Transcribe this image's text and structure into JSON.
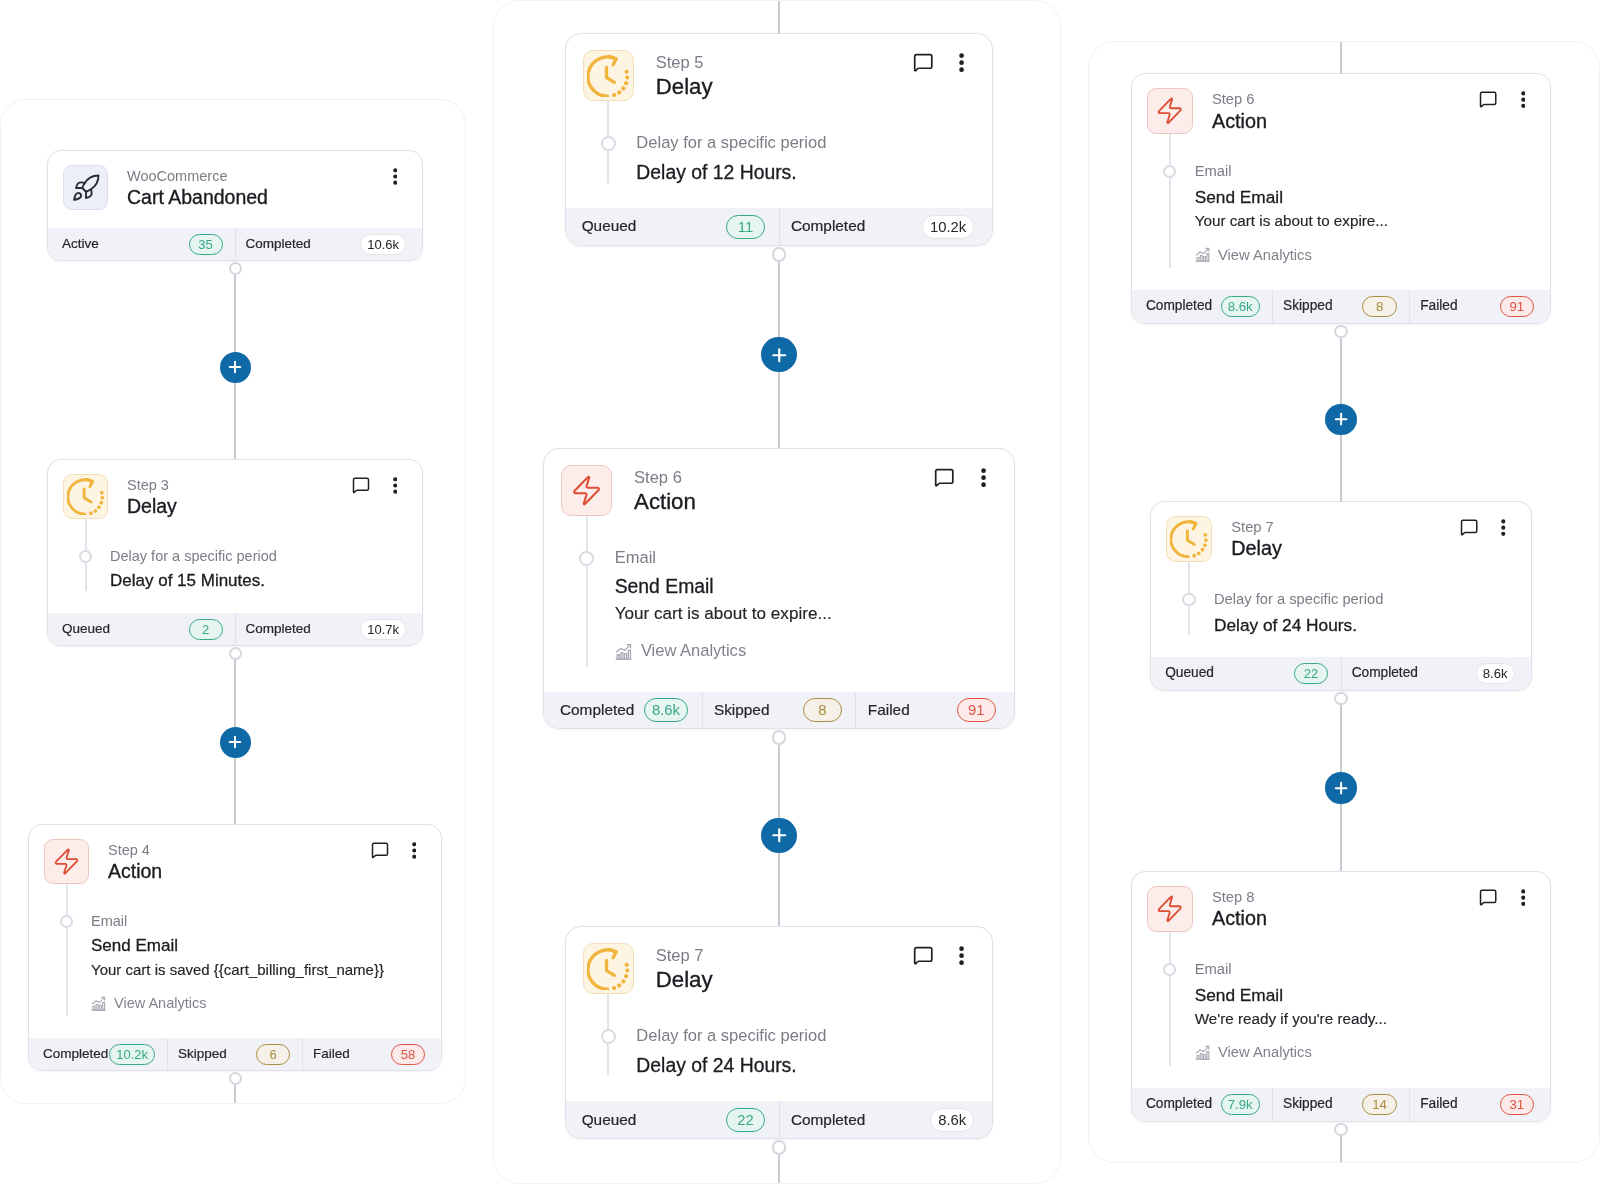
{
  "panels": [
    {
      "steps": [
        {
          "kind": "trigger",
          "label": "WooCommerce",
          "title": "Cart Abandoned",
          "stats": [
            {
              "label": "Active",
              "value": "35",
              "color": "#36a889"
            },
            {
              "label": "Completed",
              "value": "10.6k"
            }
          ]
        },
        {
          "kind": "delay",
          "label": "Step 3",
          "title": "Delay",
          "caption": "Delay for a specific period",
          "detail": "Delay of 15 Minutes.",
          "stats": [
            {
              "label": "Queued",
              "value": "2",
              "color": "#36a889"
            },
            {
              "label": "Completed",
              "value": "10.7k"
            }
          ]
        },
        {
          "kind": "action",
          "label": "Step 4",
          "title": "Action",
          "caption": "Email",
          "detail": "Send Email",
          "subject": "Your cart is saved {{cart_billing_first_name}}",
          "link": "View Analytics",
          "stats": [
            {
              "label": "Completed",
              "value": "10.2k",
              "color": "#36a889"
            },
            {
              "label": "Skipped",
              "value": "6",
              "color": "#a88c3f"
            },
            {
              "label": "Failed",
              "value": "58",
              "color": "#dc5444"
            }
          ]
        }
      ]
    },
    {
      "steps": [
        {
          "kind": "delay",
          "label": "Step 5",
          "title": "Delay",
          "caption": "Delay for a specific period",
          "detail": "Delay of 12 Hours.",
          "stats": [
            {
              "label": "Queued",
              "value": "11",
              "color": "#36a889"
            },
            {
              "label": "Completed",
              "value": "10.2k"
            }
          ]
        },
        {
          "kind": "action",
          "label": "Step 6",
          "title": "Action",
          "caption": "Email",
          "detail": "Send Email",
          "subject": "Your cart is about to expire...",
          "link": "View Analytics",
          "stats": [
            {
              "label": "Completed",
              "value": "8.6k",
              "color": "#36a889"
            },
            {
              "label": "Skipped",
              "value": "8",
              "color": "#a88c3f"
            },
            {
              "label": "Failed",
              "value": "91",
              "color": "#dc5444"
            }
          ]
        },
        {
          "kind": "delay",
          "label": "Step 7",
          "title": "Delay",
          "caption": "Delay for a specific period",
          "detail": "Delay of 24 Hours.",
          "stats": [
            {
              "label": "Queued",
              "value": "22",
              "color": "#36a889"
            },
            {
              "label": "Completed",
              "value": "8.6k"
            }
          ]
        }
      ]
    },
    {
      "steps": [
        {
          "kind": "action",
          "label": "Step 6",
          "title": "Action",
          "caption": "Email",
          "detail": "Send Email",
          "subject": "Your cart is about to expire...",
          "link": "View Analytics",
          "stats": [
            {
              "label": "Completed",
              "value": "8.6k",
              "color": "#36a889"
            },
            {
              "label": "Skipped",
              "value": "8",
              "color": "#a88c3f"
            },
            {
              "label": "Failed",
              "value": "91",
              "color": "#dc5444"
            }
          ]
        },
        {
          "kind": "delay",
          "label": "Step 7",
          "title": "Delay",
          "caption": "Delay for a specific period",
          "detail": "Delay of 24 Hours.",
          "stats": [
            {
              "label": "Queued",
              "value": "22",
              "color": "#36a889"
            },
            {
              "label": "Completed",
              "value": "8.6k"
            }
          ]
        },
        {
          "kind": "action",
          "label": "Step 8",
          "title": "Action",
          "caption": "Email",
          "detail": "Send Email",
          "subject": "We're ready if you're ready...",
          "link": "View Analytics",
          "stats": [
            {
              "label": "Completed",
              "value": "7.9k",
              "color": "#36a889"
            },
            {
              "label": "Skipped",
              "value": "14",
              "color": "#a88c3f"
            },
            {
              "label": "Failed",
              "value": "31",
              "color": "#dc5444"
            }
          ]
        }
      ]
    }
  ]
}
